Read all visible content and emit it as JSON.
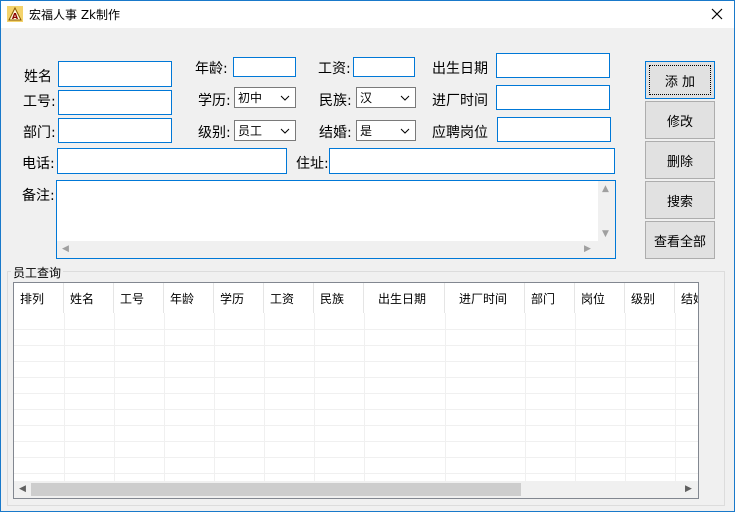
{
  "window": {
    "title": "宏福人事 Zk制作"
  },
  "form": {
    "name_label": "姓名",
    "age_label": "年龄:",
    "salary_label": "工资:",
    "birth_label": "出生日期",
    "id_label": "工号:",
    "education_label": "学历:",
    "ethnicity_label": "民族:",
    "join_label": "进厂时间",
    "dept_label": "部门:",
    "level_label": "级别:",
    "married_label": "结婚:",
    "position_label": "应聘岗位",
    "phone_label": "电话:",
    "address_label": "住址:",
    "note_label": "备注:",
    "education_value": "初中",
    "ethnicity_value": "汉",
    "level_value": "员工",
    "married_value": "是"
  },
  "buttons": {
    "add": "添 加",
    "edit": "修改",
    "delete": "删除",
    "search": "搜索",
    "view_all": "查看全部"
  },
  "group": {
    "title": "员工查询"
  },
  "table": {
    "columns": [
      "排列",
      "姓名",
      "工号",
      "年龄",
      "学历",
      "工资",
      "民族",
      "出生日期",
      "进厂时间",
      "部门",
      "岗位",
      "级别",
      "结婚"
    ]
  }
}
